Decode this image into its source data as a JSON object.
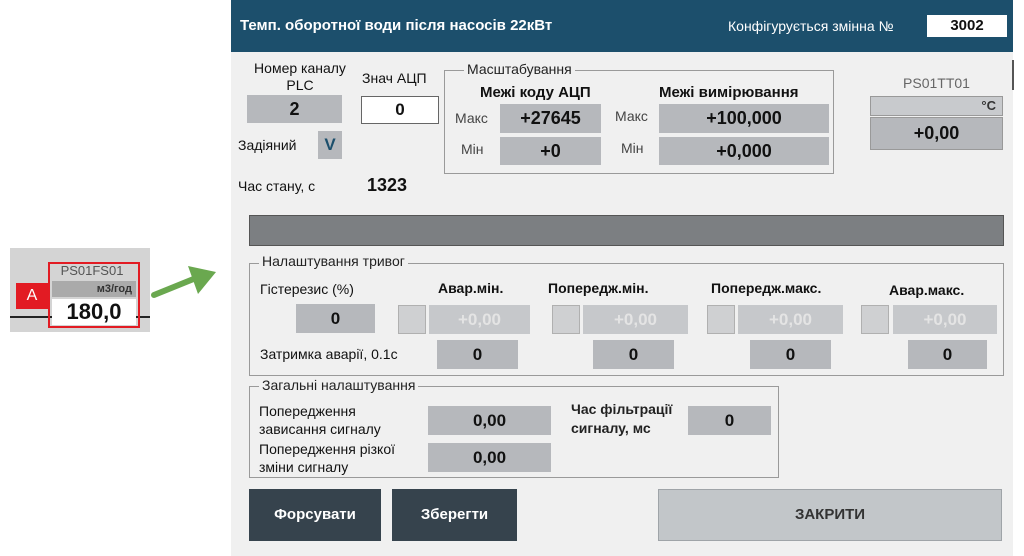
{
  "widget": {
    "tag": "PS01FS01",
    "unit": "м3/год",
    "value": "180,0",
    "alarm_badge": "A",
    "accent": "#e21b23"
  },
  "dialog": {
    "title": "Темп. оборотної води після насосів 22кВт",
    "config_label": "Конфігурується змінна №",
    "config_number": "3002",
    "titlebar_color": "#1c4f6c",
    "plc_channel_label": "Номер каналу PLC",
    "plc_channel_value": "2",
    "adc_label": "Знач АЦП",
    "adc_value": "0",
    "enabled_label": "Задіяний",
    "enabled_value": "V",
    "state_time_label": "Час стану, с",
    "state_time_value": "1323",
    "scaling": {
      "title": "Масштабування",
      "adc_limits_header": "Межі коду АЦП",
      "meas_limits_header": "Межі вимірювання",
      "max_label": "Макс",
      "min_label": "Мін",
      "adc_max": "+27645",
      "adc_min": "+0",
      "meas_max": "+100,000",
      "meas_min": "+0,000"
    },
    "sensor": {
      "tag": "PS01TT01",
      "unit": "°C",
      "value": "+0,00"
    },
    "alarms": {
      "title": "Налаштування тривог",
      "hysteresis_label": "Гістерезис (%)",
      "hysteresis_value": "0",
      "delay_label": "Затримка аварії, 0.1с",
      "columns": [
        {
          "header": "Авар.мін.",
          "value": "+0,00",
          "delay": "0"
        },
        {
          "header": "Попередж.мін.",
          "value": "+0,00",
          "delay": "0"
        },
        {
          "header": "Попередж.макс.",
          "value": "+0,00",
          "delay": "0"
        },
        {
          "header": "Авар.макс.",
          "value": "+0,00",
          "delay": "0"
        }
      ]
    },
    "general": {
      "title": "Загальні налаштування",
      "stuck_warning_label": "Попередження зависання сигналу",
      "stuck_warning_value": "0,00",
      "sharp_change_label": "Попередження різкої зміни сигналу",
      "sharp_change_value": "0,00",
      "filter_time_label": "Час фільтрації сигналу, мс",
      "filter_time_value": "0"
    },
    "buttons": {
      "force": "Форсувати",
      "save": "Зберегти",
      "close": "ЗАКРИТИ"
    }
  }
}
